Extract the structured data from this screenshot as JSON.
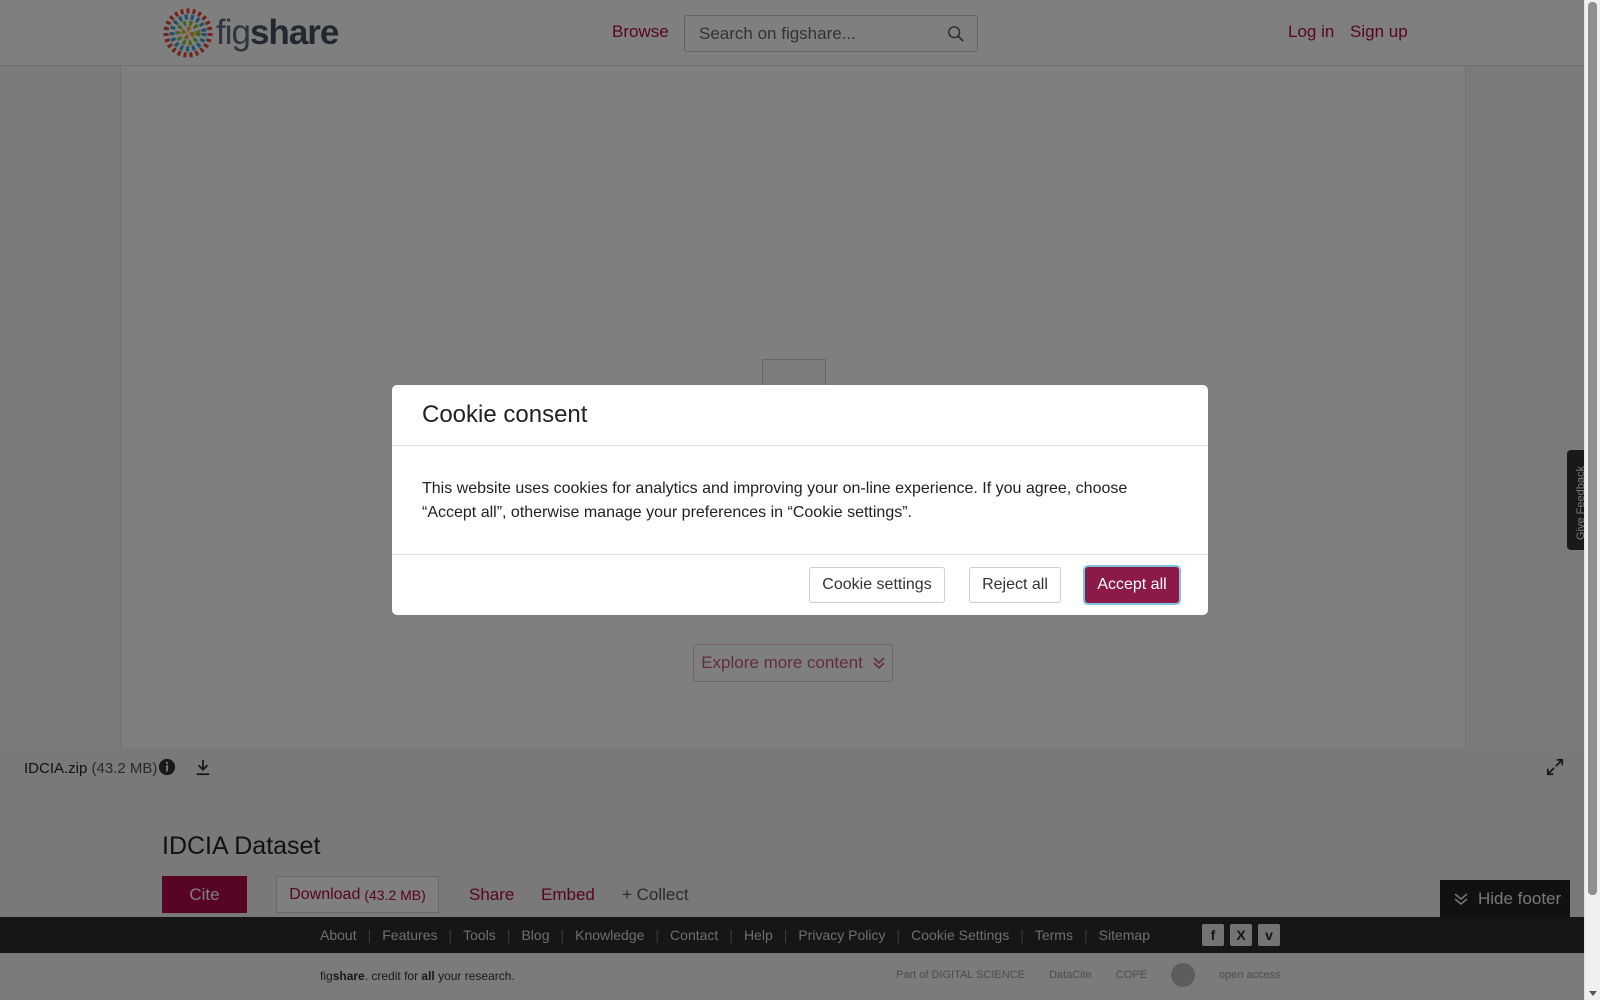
{
  "header": {
    "logo": {
      "text_light": "fig",
      "text_bold": "share"
    },
    "nav_browse": "Browse",
    "search": {
      "placeholder": "Search on figshare...",
      "value": ""
    },
    "login": "Log in",
    "signup": "Sign up"
  },
  "viewer": {
    "explore_label": "Explore more content",
    "file_name": "IDCIA.zip",
    "file_size": "(43.2 MB)"
  },
  "item": {
    "title": "IDCIA Dataset",
    "cite": "Cite",
    "download_label": "Download",
    "download_size": "(43.2 MB)",
    "share": "Share",
    "embed": "Embed",
    "collect": "+ Collect"
  },
  "hide_footer": "Hide footer",
  "feedback": "Give Feedback",
  "footer": {
    "links": [
      "About",
      "Features",
      "Tools",
      "Blog",
      "Knowledge",
      "Contact",
      "Help",
      "Privacy Policy",
      "Cookie Settings",
      "Terms",
      "Sitemap"
    ],
    "social": [
      "f",
      "X",
      "v"
    ],
    "tagline_light": "fig",
    "tagline_bold": "share",
    "tagline_rest_1": ". credit for ",
    "tagline_all": "all",
    "tagline_rest_2": " your research.",
    "partner_digital_science": "Part of DIGITAL SCIENCE",
    "partner_datacite": "DataCite",
    "partner_cope": "COPE",
    "partner_open_access": "open access"
  },
  "modal": {
    "title": "Cookie consent",
    "body": "This website uses cookies for analytics and improving your on-line experience. If you agree, choose “Accept all”, otherwise manage your preferences in “Cookie settings”.",
    "settings": "Cookie settings",
    "reject": "Reject all",
    "accept": "Accept all"
  },
  "colors": {
    "brand": "#b0084a",
    "accept_button": "#8b1a4b",
    "footer_dark": "#2c2c2c"
  }
}
